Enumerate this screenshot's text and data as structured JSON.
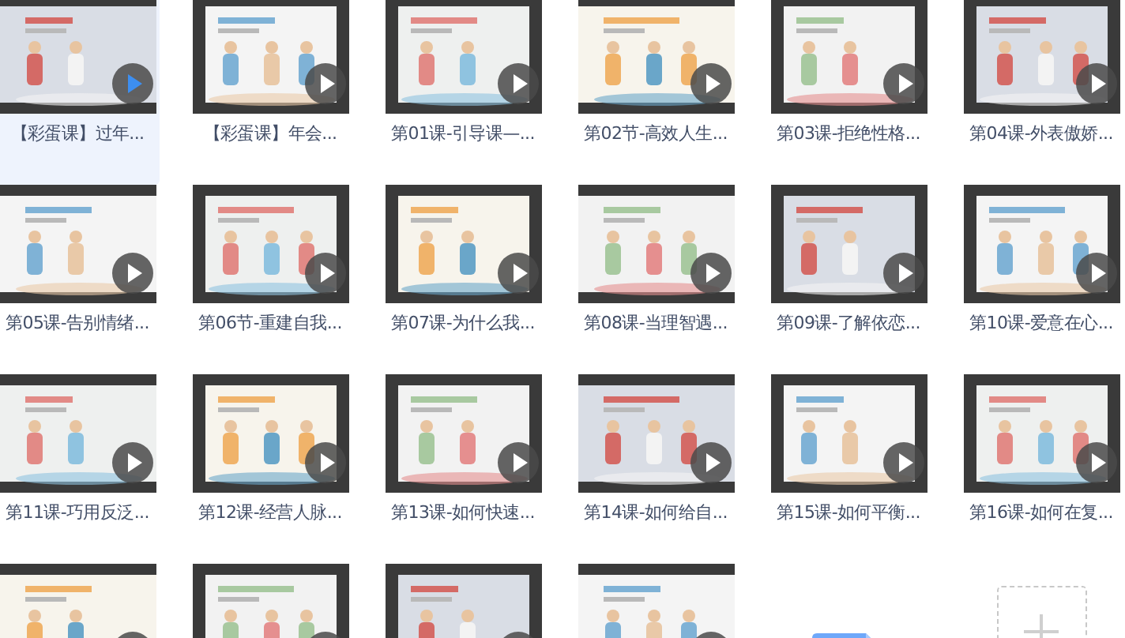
{
  "items": [
    {
      "kind": "video",
      "title": "【彩蛋课】过年...",
      "selected": true
    },
    {
      "kind": "video",
      "title": "【彩蛋课】年会...",
      "selected": false
    },
    {
      "kind": "video",
      "title": "第01课-引导课—...",
      "selected": false
    },
    {
      "kind": "video",
      "title": "第02节-高效人生...",
      "selected": false
    },
    {
      "kind": "video",
      "title": "第03课-拒绝性格...",
      "selected": false
    },
    {
      "kind": "video",
      "title": "第04课-外表傲娇...",
      "selected": false
    },
    {
      "kind": "video",
      "title": "第05课-告别情绪...",
      "selected": false
    },
    {
      "kind": "video",
      "title": "第06节-重建自我...",
      "selected": false
    },
    {
      "kind": "video",
      "title": "第07课-为什么我...",
      "selected": false
    },
    {
      "kind": "video",
      "title": "第08课-当理智遇...",
      "selected": false
    },
    {
      "kind": "video",
      "title": "第09课-了解依恋...",
      "selected": false
    },
    {
      "kind": "video",
      "title": "第10课-爱意在心...",
      "selected": false
    },
    {
      "kind": "video",
      "title": "第11课-巧用反泛...",
      "selected": false
    },
    {
      "kind": "video",
      "title": "第12课-经营人脉...",
      "selected": false
    },
    {
      "kind": "video",
      "title": "第13课-如何快速...",
      "selected": false
    },
    {
      "kind": "video",
      "title": "第14课-如何给自...",
      "selected": false
    },
    {
      "kind": "video",
      "title": "第15课-如何平衡...",
      "selected": false
    },
    {
      "kind": "video",
      "title": "第16课-如何在复...",
      "selected": false
    },
    {
      "kind": "video",
      "selected": false
    },
    {
      "kind": "video",
      "selected": false
    },
    {
      "kind": "video",
      "selected": false
    },
    {
      "kind": "video",
      "selected": false
    },
    {
      "kind": "doc",
      "selected": false
    },
    {
      "kind": "add",
      "selected": false
    }
  ]
}
